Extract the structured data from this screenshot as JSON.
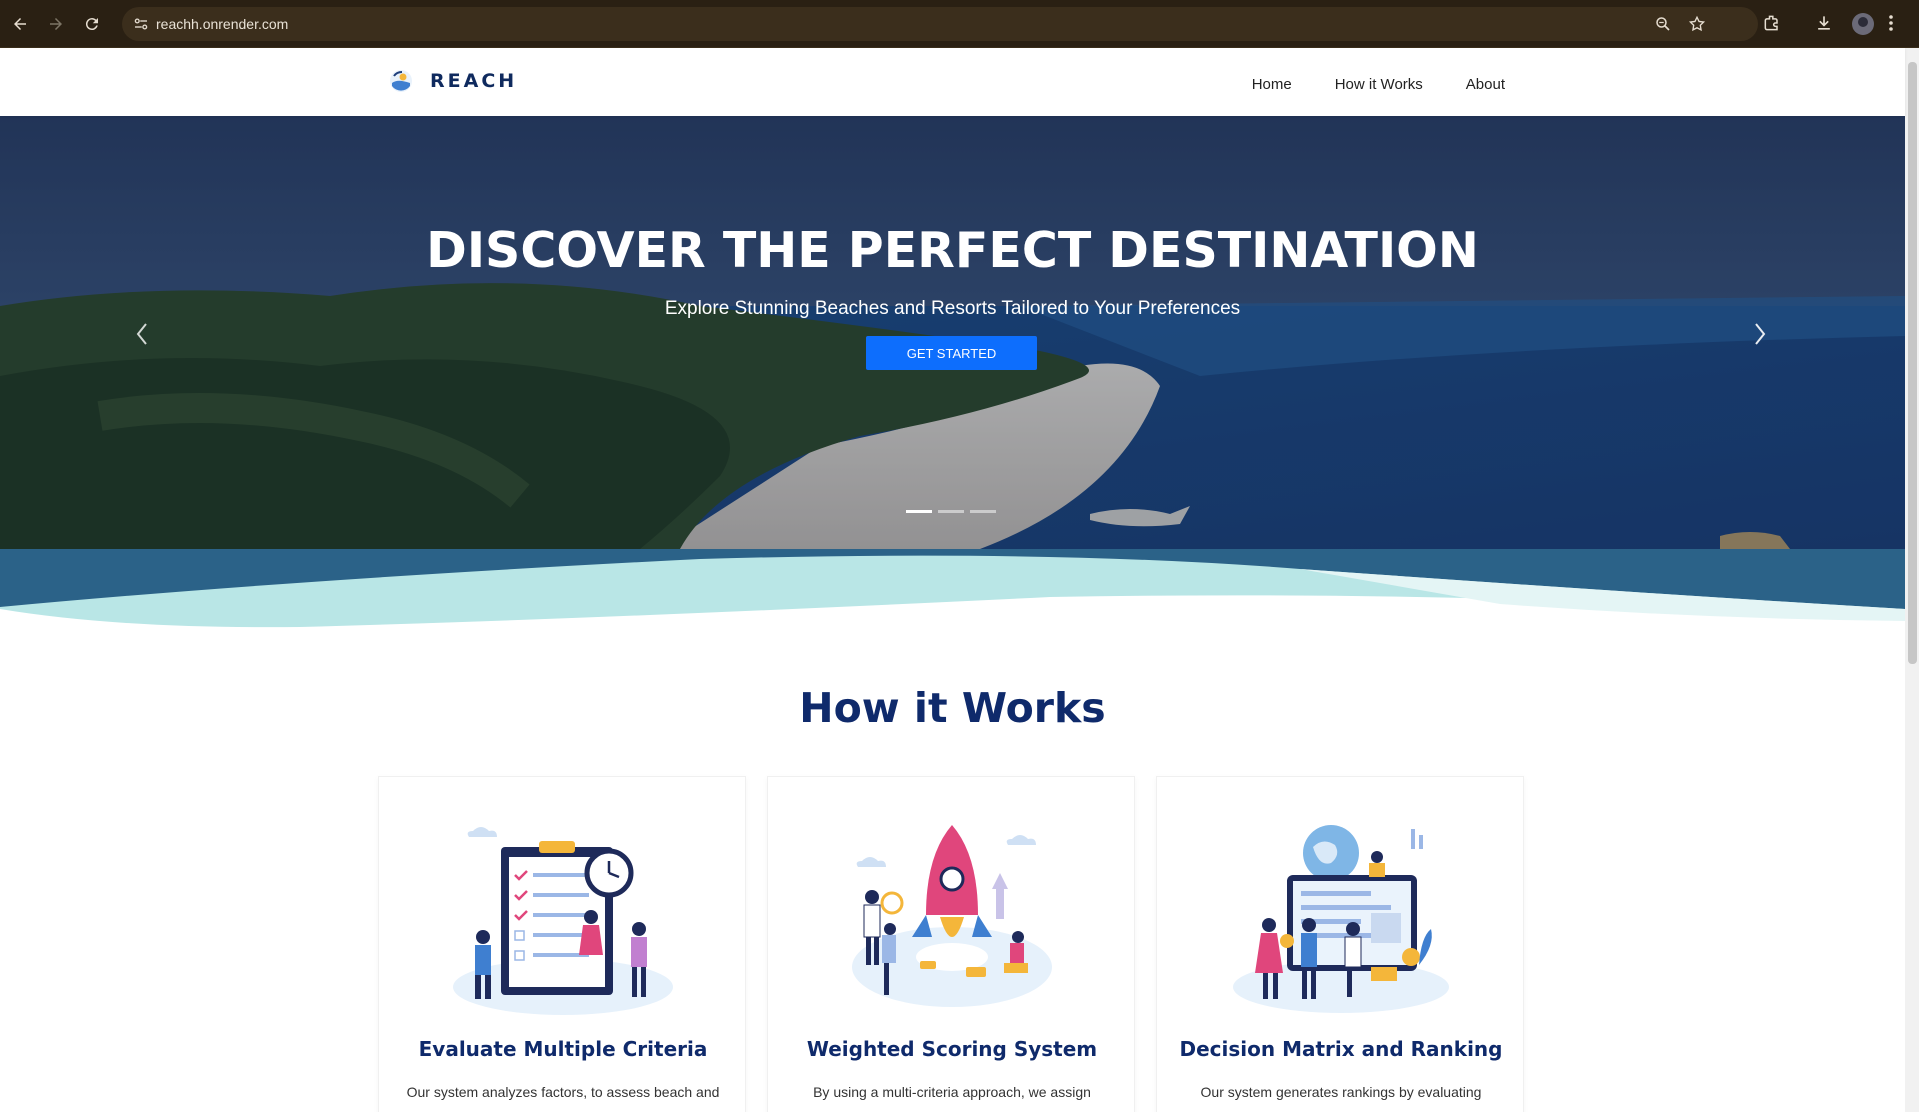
{
  "browser": {
    "url": "reachh.onrender.com"
  },
  "header": {
    "brand": "REACH",
    "nav": [
      "Home",
      "How it Works",
      "About"
    ]
  },
  "hero": {
    "title": "DISCOVER THE PERFECT DESTINATION",
    "subtitle": "Explore Stunning Beaches and Resorts Tailored to Your Preferences",
    "cta_label": "GET STARTED",
    "slide_count": 3,
    "active_slide": 1
  },
  "how_it_works": {
    "title": "How it Works",
    "cards": [
      {
        "title": "Evaluate Multiple Criteria",
        "text": "Our system analyzes factors, to assess beach and"
      },
      {
        "title": "Weighted Scoring System",
        "text": "By using a multi-criteria approach, we assign"
      },
      {
        "title": "Decision Matrix and Ranking",
        "text": "Our system generates rankings by evaluating"
      }
    ]
  },
  "colors": {
    "primary_navy": "#0f2a6b",
    "cta_blue": "#0d6efd",
    "wave_dark": "#2b6288",
    "wave_light": "#b9e6e6"
  }
}
